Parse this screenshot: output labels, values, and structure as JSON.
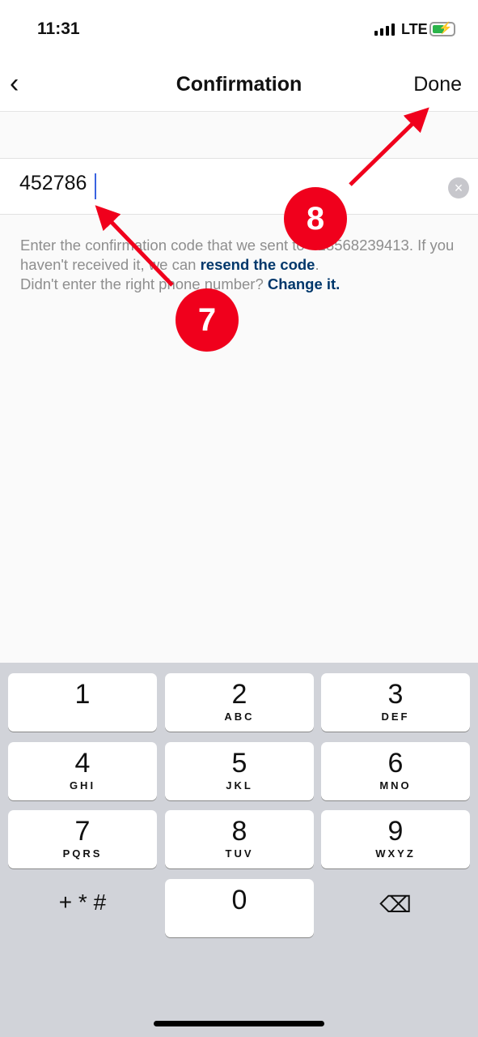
{
  "status_bar": {
    "time": "11:31",
    "network": "LTE",
    "icons": [
      "signal-icon",
      "battery-charging-icon"
    ]
  },
  "nav": {
    "back_icon": "chevron-left-icon",
    "title": "Confirmation",
    "done_label": "Done"
  },
  "code_field": {
    "value": "452786",
    "clear_icon": "clear-circle-icon"
  },
  "help": {
    "line1": "Enter the confirmation code that we sent to +18568239413. If you haven't received it, we can ",
    "resend_link": "resend the code",
    "line1_end": ".",
    "line2": "Didn't enter the right phone number? ",
    "change_link": "Change it."
  },
  "keyboard": {
    "keys": [
      {
        "n": "1",
        "l": ""
      },
      {
        "n": "2",
        "l": "ABC"
      },
      {
        "n": "3",
        "l": "DEF"
      },
      {
        "n": "4",
        "l": "GHI"
      },
      {
        "n": "5",
        "l": "JKL"
      },
      {
        "n": "6",
        "l": "MNO"
      },
      {
        "n": "7",
        "l": "PQRS"
      },
      {
        "n": "8",
        "l": "TUV"
      },
      {
        "n": "9",
        "l": "WXYZ"
      },
      {
        "n": "0",
        "l": ""
      }
    ],
    "symbols": "+ * #",
    "delete_icon": "backspace-icon"
  },
  "annotations": {
    "step7": "7",
    "step8": "8",
    "color": "#f0001c"
  }
}
